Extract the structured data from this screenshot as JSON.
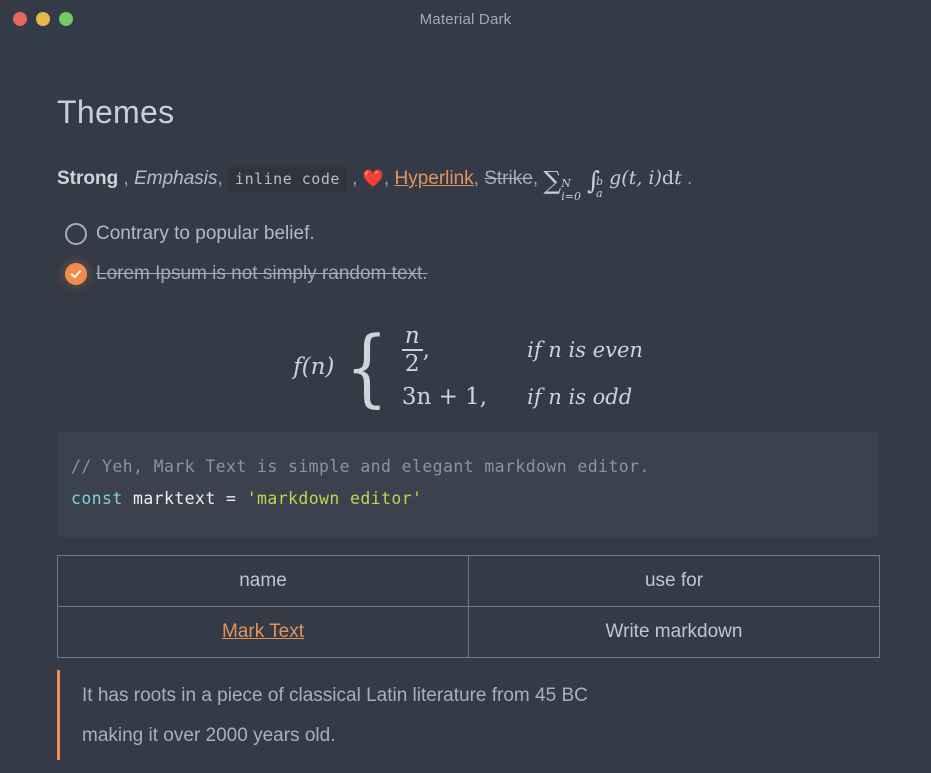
{
  "window": {
    "title": "Material Dark",
    "controls": [
      {
        "name": "close",
        "color": "#e4695e"
      },
      {
        "name": "minimize",
        "color": "#e9b84b"
      },
      {
        "name": "zoom",
        "color": "#74c763"
      }
    ]
  },
  "document": {
    "heading": "Themes",
    "inline_demo": {
      "strong": "Strong",
      "sep1": " , ",
      "emphasis": "Emphasis",
      "sep2": ", ",
      "code": "inline code",
      "sep3": " , ",
      "heart": "❤️",
      "sep4": ", ",
      "link": "Hyperlink",
      "sep5": ", ",
      "strike": "Strike",
      "sep6": ", ",
      "math_tex": "\\sum_{i=0}^{N} \\int_a^b g(t,i)\\mathrm{d}t",
      "math_parts": {
        "sigma": "∑",
        "sigma_sup": "N",
        "sigma_sub": "i=0",
        "integral": "∫",
        "int_sup": "b",
        "int_sub": "a",
        "body": "g(t, i)",
        "differential": "d",
        "variable": "t"
      },
      "end_period": "."
    },
    "task_list": [
      {
        "label": "Contrary to popular belief.",
        "checked": false
      },
      {
        "label": "Lorem Ipsum is not simply random text.",
        "checked": true
      }
    ],
    "math_block": {
      "tex": "f(n) \\begin{cases} \\frac{n}{2}, & if\\ n\\ is\\ even \\\\ 3n+1, & if\\ n\\ is\\ odd \\end{cases}",
      "function": "f(n)",
      "cases": [
        {
          "value_num": "n",
          "value_den": "2",
          "comma": ",",
          "condition": "if n is even"
        },
        {
          "value": "3n + 1,",
          "condition": "if n is odd"
        }
      ]
    },
    "code_block": {
      "language": "javascript",
      "comment": "// Yeh, Mark Text is simple and elegant markdown editor.",
      "keyword": "const",
      "identifier": " marktext = ",
      "string": "'markdown editor'"
    },
    "table": {
      "headers": [
        "name",
        "use for"
      ],
      "rows": [
        {
          "name": "Mark Text",
          "name_is_link": true,
          "use_for": "Write markdown"
        }
      ]
    },
    "blockquote": {
      "lines": [
        "It has roots in a piece of classical Latin literature from 45 BC",
        "making it over 2000 years old."
      ]
    }
  },
  "theme": {
    "background": "#343a46",
    "code_background": "#3b414d",
    "inline_code_background": "#2f343d",
    "accent": "#ef8e4c",
    "link": "#e3945d",
    "text": "#b3bac4",
    "heading": "#c9cfd8",
    "table_border": "#737a86",
    "code_keyword": "#7fd1d9",
    "code_string": "#c3d44f",
    "code_comment": "#8d949e"
  }
}
